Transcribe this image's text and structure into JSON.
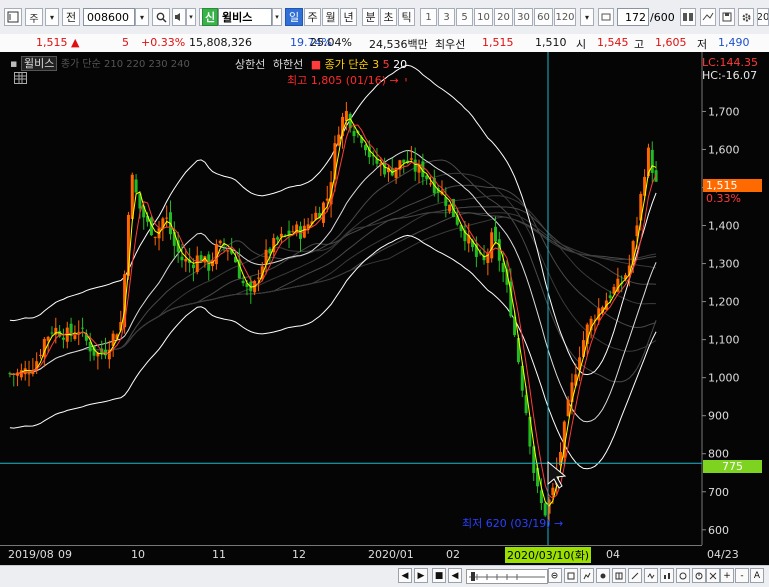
{
  "toolbar": {
    "market_btn": "주",
    "prev_btn": "전",
    "code": "008600",
    "stock_badge": "신",
    "stock_name": "윌비스",
    "periods": [
      "일",
      "주",
      "월",
      "년",
      "분",
      "초",
      "틱"
    ],
    "periods_selected": "일",
    "nums": [
      "1",
      "3",
      "5",
      "10",
      "20",
      "30",
      "60",
      "120"
    ],
    "count": "172",
    "total": "/600",
    "right_edge": "20"
  },
  "quote": {
    "price": "1,515",
    "arrow": "▲",
    "change": "5",
    "change_pct": "+0.33%",
    "volume": "15,808,326",
    "turnover_pct": "19.74%",
    "ratio_pct": "25.04%",
    "amount": "24,536백만",
    "best_bid_label": "최우선",
    "best_ask": "1,515",
    "best_bid": "1,510",
    "open_label": "시",
    "open": "1,545",
    "high_label": "고",
    "high": "1,605",
    "low_label": "저",
    "low": "1,490"
  },
  "chart": {
    "stock_tag": "윌비스",
    "ma_legend": "종가 단순 210 220 230 240",
    "upper_limit": "상한선",
    "lower_limit": "하한선",
    "close_simple": "종가 단순",
    "ma_periods": [
      "3",
      "5",
      "20"
    ],
    "max_label": "최고 1,805 (01/16)",
    "min_label": "최저 620 (03/19)",
    "lc_label": "LC:144.35",
    "hc_label": "HC:-16.07",
    "price_tag": "1,515",
    "pct_tag": "0.33%",
    "hline_tag": "775",
    "cursor_date": "2020/03/10(화)",
    "colors": {
      "up": "#ff6600",
      "down": "#22bb22",
      "ma3": "#ffff00",
      "ma5": "#ff3b3b",
      "band": "#ffffff",
      "crosshair": "#20b8c8"
    }
  },
  "chart_data": {
    "type": "candlestick",
    "x_axis": [
      "2019/08",
      "09",
      "10",
      "11",
      "12",
      "2020/01",
      "02",
      "04",
      "04/23"
    ],
    "y_ticks": [
      600,
      700,
      800,
      900,
      1000,
      1100,
      1200,
      1300,
      1400,
      1500,
      1600,
      1700
    ],
    "ylim": [
      560,
      1830
    ],
    "close_path": [
      1010,
      1010,
      1020,
      1040,
      1100,
      1130,
      1120,
      1110,
      1130,
      1090,
      1060,
      1070,
      1110,
      1150,
      1540,
      1450,
      1400,
      1380,
      1430,
      1350,
      1310,
      1300,
      1320,
      1290,
      1340,
      1350,
      1320,
      1250,
      1210,
      1290,
      1330,
      1360,
      1370,
      1390,
      1380,
      1420,
      1440,
      1480,
      1650,
      1700,
      1650,
      1630,
      1570,
      1560,
      1540,
      1560,
      1570,
      1550,
      1540,
      1510,
      1490,
      1450,
      1410,
      1370,
      1320,
      1300,
      1370,
      1300,
      1200,
      1050,
      900,
      720,
      640,
      700,
      820,
      950,
      1060,
      1130,
      1170,
      1200,
      1230,
      1250,
      1300,
      1440,
      1600,
      1515
    ],
    "max": {
      "value": 1805,
      "date": "01/16"
    },
    "min": {
      "value": 620,
      "date": "03/19"
    },
    "current": 1515,
    "hline": 775
  },
  "bottom": {
    "buttons": [
      "◀",
      "▶",
      "■",
      "◀",
      "▶",
      "+",
      "-",
      "A"
    ]
  }
}
